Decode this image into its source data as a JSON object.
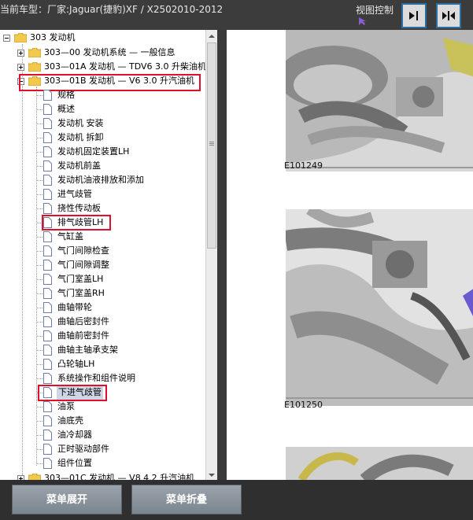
{
  "header": {
    "title": "当前车型：厂家:Jaguar(捷豹)XF / X2502010-2012",
    "view_control_label": "视图控制"
  },
  "tree": {
    "root": "303 发动机",
    "groups": [
      "303—00 发动机系统 — 一般信息",
      "303—01A 发动机 — TDV6 3.0 升柴油机",
      "303—01B 发动机 — V6 3.0 升汽油机"
    ],
    "items": [
      "规格",
      "概述",
      "发动机 安装",
      "发动机 拆卸",
      "发动机固定装置LH",
      "发动机前盖",
      "发动机油液排放和添加",
      "进气歧管",
      "挠性传动板",
      "排气歧管LH",
      "气缸盖",
      "气门间隙检查",
      "气门间隙调整",
      "气门室盖LH",
      "气门室盖RH",
      "曲轴带轮",
      "曲轴后密封件",
      "曲轴前密封件",
      "曲轴主轴承支架",
      "凸轮轴LH",
      "系统操作和组件说明",
      "下进气歧管",
      "油泵",
      "油底壳",
      "油冷却器",
      "正时驱动部件",
      "组件位置"
    ],
    "last_group": "303—01C 发动机 — V8 4.2 升汽油机"
  },
  "figures": [
    "E101249",
    "E101250"
  ],
  "footer": {
    "expand_label": "菜单展开",
    "collapse_label": "菜单折叠"
  }
}
